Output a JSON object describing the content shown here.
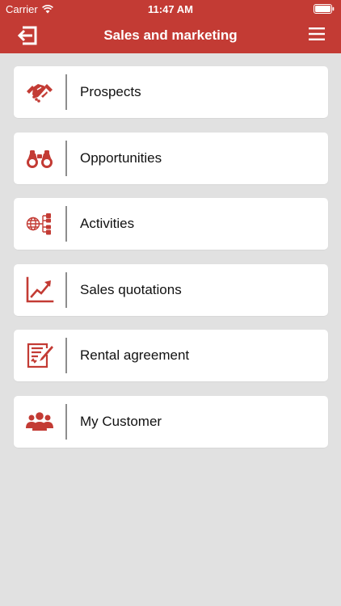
{
  "status_bar": {
    "carrier": "Carrier",
    "time": "11:47 AM"
  },
  "navbar": {
    "title": "Sales and marketing",
    "left_icon": "logout-icon",
    "right_icon": "hamburger-menu-icon"
  },
  "accent_color": "#c33b34",
  "menu": {
    "items": [
      {
        "label": "Prospects",
        "icon": "handshake-icon"
      },
      {
        "label": "Opportunities",
        "icon": "binoculars-icon"
      },
      {
        "label": "Activities",
        "icon": "network-globe-icon"
      },
      {
        "label": "Sales quotations",
        "icon": "trend-chart-icon"
      },
      {
        "label": "Rental agreement",
        "icon": "contract-pen-icon"
      },
      {
        "label": "My Customer",
        "icon": "group-users-icon"
      }
    ]
  }
}
